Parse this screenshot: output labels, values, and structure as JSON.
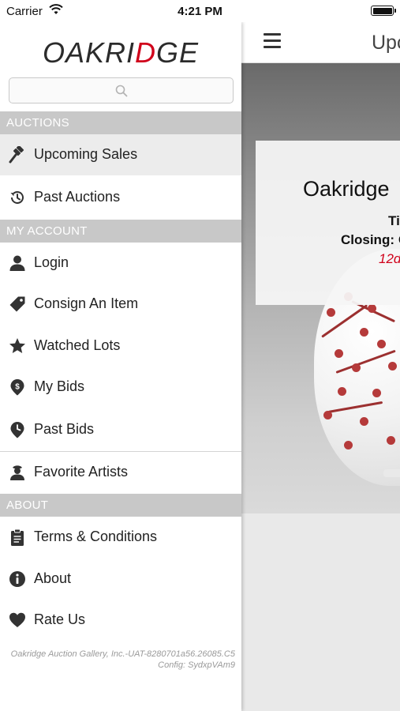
{
  "status_bar": {
    "carrier": "Carrier",
    "time": "4:21 PM",
    "battery_level": 1.0
  },
  "drawer": {
    "logo": {
      "text_main": "OAKRI",
      "text_accent": "D",
      "text_end": "GE",
      "brand_color": "#d0021b"
    },
    "search": {
      "placeholder": "",
      "icon": "search-icon"
    },
    "sections": {
      "auctions": "AUCTIONS",
      "my_account": "MY ACCOUNT",
      "about": "ABOUT"
    },
    "items": {
      "upcoming_sales": {
        "label": "Upcoming Sales",
        "icon": "gavel-icon",
        "selected": true
      },
      "past_auctions": {
        "label": "Past Auctions",
        "icon": "history-icon"
      },
      "login": {
        "label": "Login",
        "icon": "user-icon"
      },
      "consign": {
        "label": "Consign An Item",
        "icon": "tag-icon"
      },
      "watched": {
        "label": "Watched Lots",
        "icon": "star-icon"
      },
      "my_bids": {
        "label": "My Bids",
        "icon": "dollar-pin-icon"
      },
      "past_bids": {
        "label": "Past Bids",
        "icon": "clock-pin-icon"
      },
      "favorite_artists": {
        "label": "Favorite Artists",
        "icon": "artist-icon"
      },
      "terms": {
        "label": "Terms & Conditions",
        "icon": "clipboard-icon"
      },
      "about": {
        "label": "About",
        "icon": "info-icon"
      },
      "rate_us": {
        "label": "Rate Us",
        "icon": "heart-icon"
      }
    },
    "footer": {
      "line1": "Oakridge Auction Gallery, Inc.-UAT-8280701a56.26085.C5",
      "line2": "Config: SydxpVAm9"
    }
  },
  "main": {
    "title": "Upc",
    "sale": {
      "name": "Oakridge",
      "time_label": "Ti",
      "closing_label": "Closing:",
      "closing_value": "C",
      "countdown": "12d"
    },
    "accent_color": "#d0021b"
  }
}
